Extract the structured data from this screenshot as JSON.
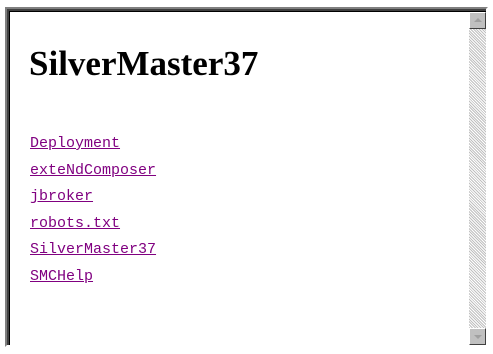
{
  "page": {
    "title": "SilverMaster37"
  },
  "links": [
    {
      "label": "Deployment"
    },
    {
      "label": "exteNdComposer"
    },
    {
      "label": "jbroker"
    },
    {
      "label": "robots.txt"
    },
    {
      "label": "SilverMaster37"
    },
    {
      "label": "SMCHelp"
    }
  ],
  "colors": {
    "link_visited": "#800080",
    "background": "#ffffff",
    "scrollbar_face": "#c0c0c0"
  },
  "icons": {
    "scroll_up": "triangle-up-icon",
    "scroll_down": "triangle-down-icon"
  }
}
